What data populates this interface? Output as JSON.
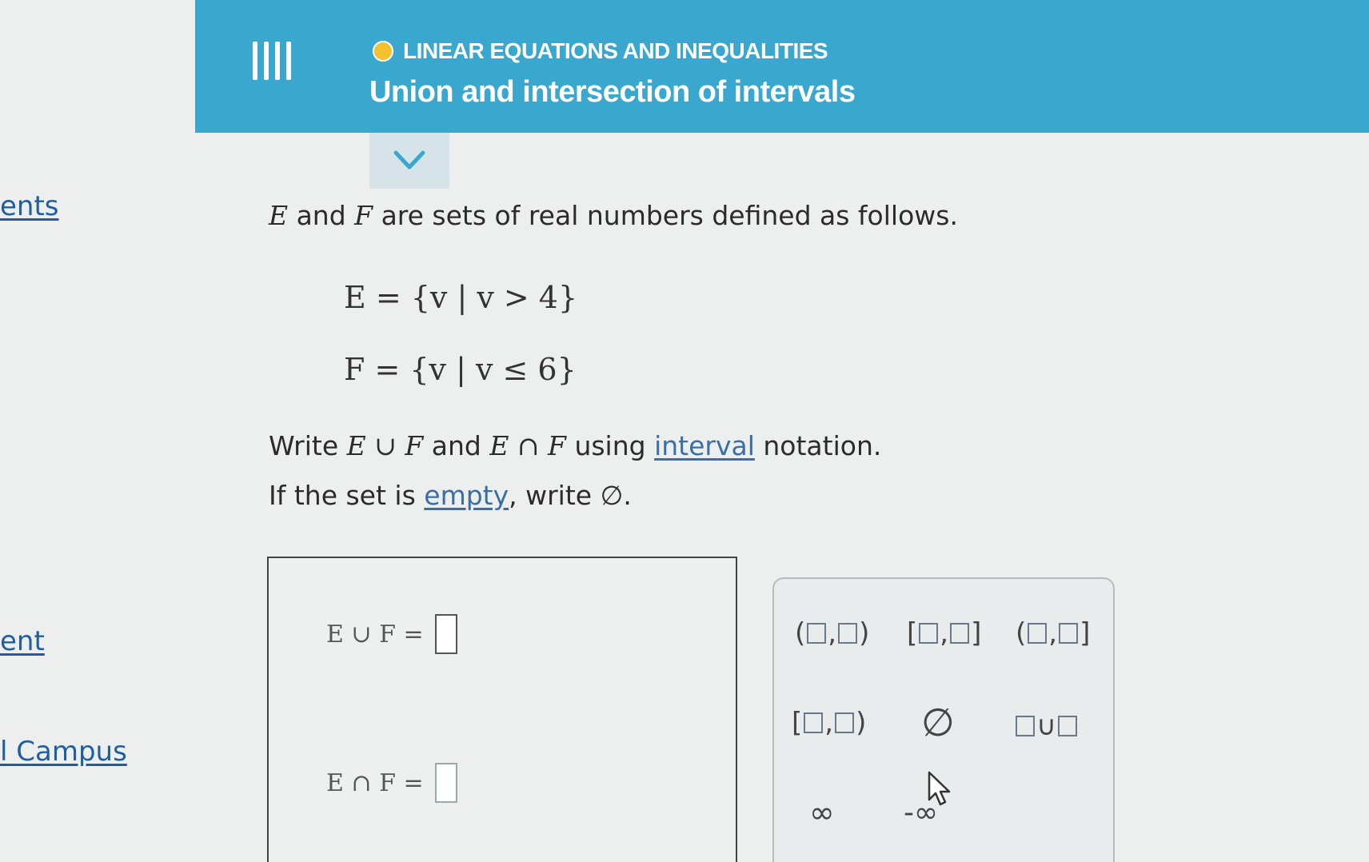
{
  "sidebar": {
    "items": [
      {
        "label": "ents"
      },
      {
        "label": "ent"
      },
      {
        "label": "l Campus"
      }
    ]
  },
  "header": {
    "topic": "LINEAR EQUATIONS AND INEQUALITIES",
    "title": "Union and intersection of intervals"
  },
  "problem": {
    "intro_E": "E",
    "intro_and": " and ",
    "intro_F": "F",
    "intro_rest": " are sets of real numbers defined as follows.",
    "set_E": "E = {v | v > 4}",
    "set_F": "F = {v | v ≤ 6}",
    "write_1": "Write ",
    "union_expr": "E ∪ F",
    "write_and": " and ",
    "intersection_expr": "E ∩ F",
    "write_using": " using ",
    "interval_link": "interval",
    "write_notation": " notation.",
    "empty_1": "If the set is ",
    "empty_link": "empty",
    "empty_2": ", write ",
    "empty_symbol": "∅",
    "empty_period": "."
  },
  "answers": {
    "union_label": "E ∪ F =",
    "union_value": "",
    "intersection_label": "E ∩ F =",
    "intersection_value": ""
  },
  "keypad": {
    "open_open_l": "(",
    "open_open_r": ")",
    "closed_closed_l": "[",
    "closed_closed_r": "]",
    "open_closed_l": "(",
    "open_closed_r": "]",
    "closed_open_l": "[",
    "closed_open_r": ")",
    "comma": ",",
    "empty_set": "∅",
    "union_symbol": "∪",
    "infinity": "∞",
    "neg_infinity": "-∞"
  }
}
